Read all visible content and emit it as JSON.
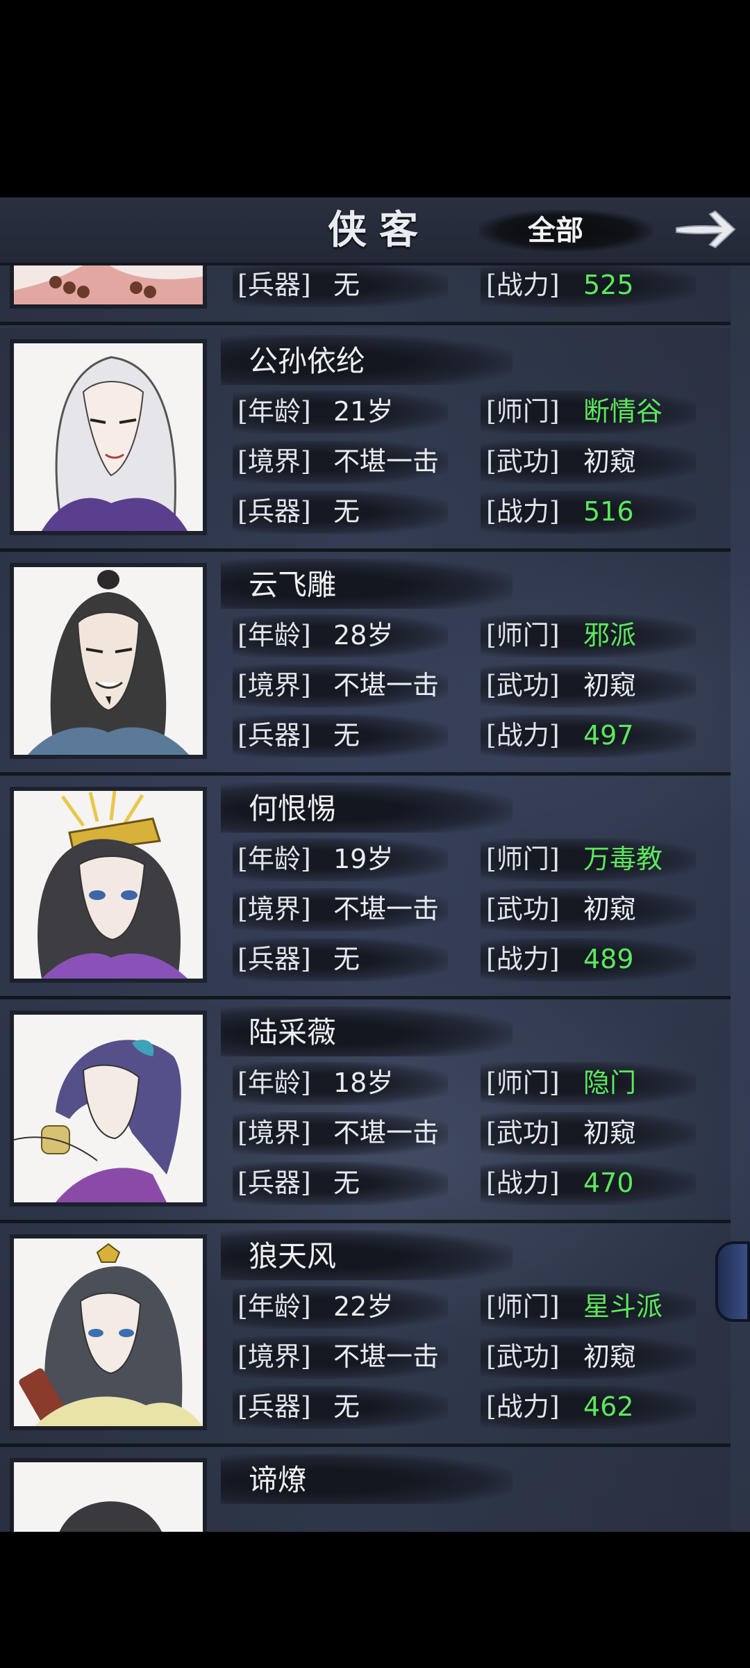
{
  "header": {
    "title": "侠客",
    "filter_label": "全部"
  },
  "labels": {
    "age": "[年龄]",
    "sect": "[师门]",
    "realm": "[境界]",
    "skill": "[武功]",
    "weapon": "[兵器]",
    "power": "[战力]"
  },
  "first_partial": {
    "weapon": "无",
    "power": "525"
  },
  "characters": [
    {
      "name": "公孙依纶",
      "age": "21岁",
      "sect": "断情谷",
      "realm": "不堪一击",
      "skill": "初窥",
      "weapon": "无",
      "power": "516"
    },
    {
      "name": "云飞雕",
      "age": "28岁",
      "sect": "邪派",
      "realm": "不堪一击",
      "skill": "初窥",
      "weapon": "无",
      "power": "497"
    },
    {
      "name": "何恨惕",
      "age": "19岁",
      "sect": "万毒教",
      "realm": "不堪一击",
      "skill": "初窥",
      "weapon": "无",
      "power": "489"
    },
    {
      "name": "陆采薇",
      "age": "18岁",
      "sect": "隐门",
      "realm": "不堪一击",
      "skill": "初窥",
      "weapon": "无",
      "power": "470"
    },
    {
      "name": "狼天风",
      "age": "22岁",
      "sect": "星斗派",
      "realm": "不堪一击",
      "skill": "初窥",
      "weapon": "无",
      "power": "462"
    }
  ],
  "last_partial": {
    "name": "谛燎"
  },
  "colors": {
    "accent_green": "#5ce85e",
    "background": "#2f3748"
  },
  "icons": {
    "next": "right-arrow-icon",
    "side": "book-icon"
  }
}
